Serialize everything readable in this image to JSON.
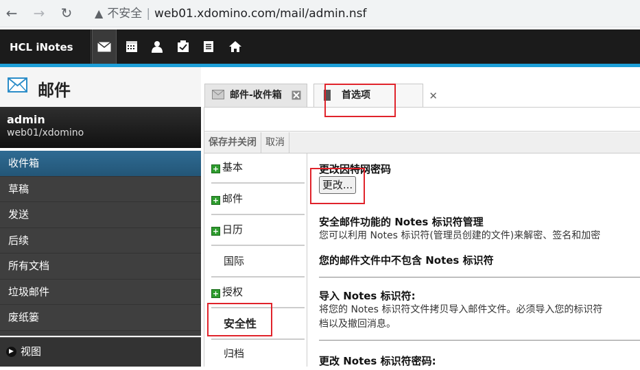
{
  "browser": {
    "insecure_label": "不安全",
    "url": "web01.xdomino.com/mail/admin.nsf"
  },
  "app": {
    "brand": "HCL iNotes",
    "header_icons": [
      "mail-icon",
      "calendar-icon",
      "contacts-icon",
      "todo-icon",
      "notebook-icon",
      "home-icon"
    ]
  },
  "mailpanel": {
    "title": "邮件",
    "user_name": "admin",
    "user_server": "web01/xdomino",
    "nav_items": [
      "收件箱",
      "草稿",
      "发送",
      "后续",
      "所有文档",
      "垃圾邮件",
      "废纸篓"
    ],
    "active_index": 0,
    "view_label": "视图"
  },
  "tabs": [
    {
      "label": "邮件-收件箱",
      "active": false
    },
    {
      "label": "首选项",
      "active": true
    }
  ],
  "actions": {
    "save_close": "保存并关闭",
    "cancel": "取消"
  },
  "pref_nav": [
    {
      "label": "基本",
      "expandable": true
    },
    {
      "label": "邮件",
      "expandable": true
    },
    {
      "label": "日历",
      "expandable": true
    },
    {
      "label": "国际",
      "expandable": false
    },
    {
      "label": "授权",
      "expandable": true
    },
    {
      "label": "安全性",
      "expandable": false,
      "selected": true
    },
    {
      "label": "归档",
      "expandable": false
    }
  ],
  "security": {
    "internet_pw_heading": "更改因特网密码",
    "change_button": "更改...",
    "notes_id_heading": "安全邮件功能的 Notes 标识符管理",
    "notes_id_desc": "您可以利用 Notes 标识符(管理员创建的文件)来解密、签名和加密",
    "no_id_heading": "您的邮件文件中不包含 Notes 标识符",
    "import_heading": "导入 Notes 标识符:",
    "import_desc_line1": "将您的 Notes 标识符文件拷贝导入邮件文件。必须导入您的标识符",
    "import_desc_line2": "档以及撤回消息。",
    "change_id_pw_heading": "更改 Notes 标识符密码:"
  },
  "colors": {
    "accent_blue": "#1e9fd8",
    "active_nav": "#2f6b93",
    "highlight_red": "#e0222a"
  }
}
